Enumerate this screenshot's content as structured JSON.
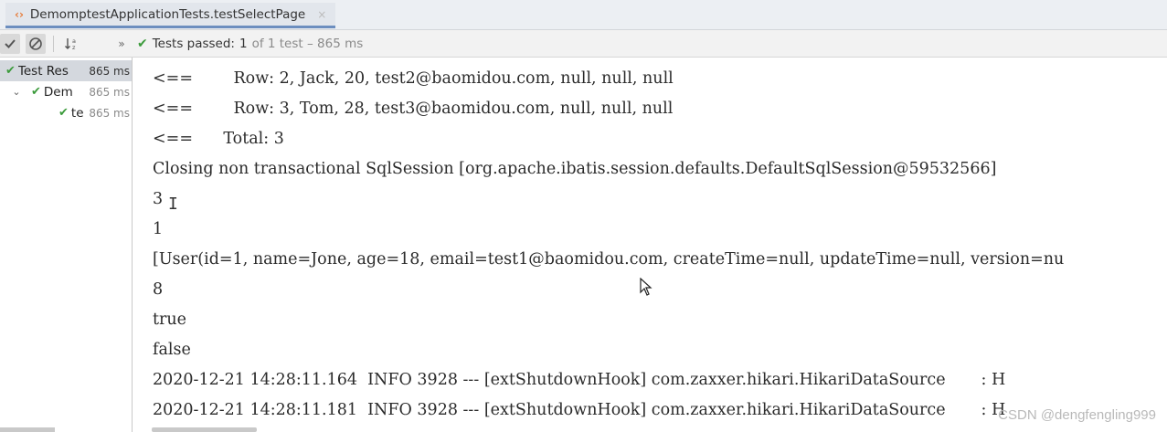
{
  "tab": {
    "title": "DemomptestApplicationTests.testSelectPage",
    "close": "×"
  },
  "toolbar": {
    "status_passed": "Tests passed:",
    "status_count": "1",
    "status_detail": "of 1 test – 865 ms"
  },
  "tree": {
    "items": [
      {
        "label": "Test Res",
        "time": "865 ms"
      },
      {
        "label": "Dem",
        "time": "865 ms"
      },
      {
        "label": "te",
        "time": "865 ms"
      }
    ]
  },
  "console": {
    "lines": [
      "<==        Row: 2, Jack, 20, test2@baomidou.com, null, null, null",
      "<==        Row: 3, Tom, 28, test3@baomidou.com, null, null, null",
      "<==      Total: 3",
      "Closing non transactional SqlSession [org.apache.ibatis.session.defaults.DefaultSqlSession@59532566]",
      "3",
      "1",
      "[User(id=1, name=Jone, age=18, email=test1@baomidou.com, createTime=null, updateTime=null, version=nu",
      "8",
      "true",
      "false",
      "2020-12-21 14:28:11.164  INFO 3928 --- [extShutdownHook] com.zaxxer.hikari.HikariDataSource       : H",
      "2020-12-21 14:28:11.181  INFO 3928 --- [extShutdownHook] com.zaxxer.hikari.HikariDataSource       : H"
    ]
  },
  "watermark": "CSDN @dengfengling999",
  "colors": {
    "pass_green": "#3c9b3c",
    "tab_accent": "#6c8ebf"
  }
}
